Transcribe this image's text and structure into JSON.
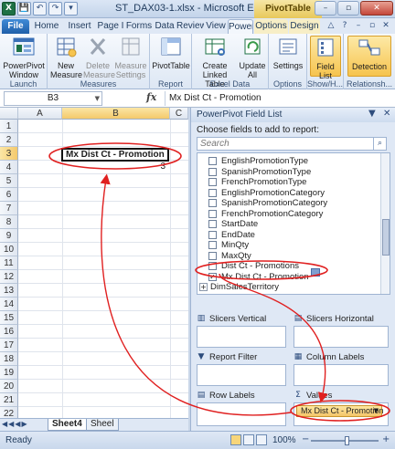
{
  "window": {
    "title": "ST_DAX03-1.xlsx - Microsoft Excel",
    "context_tab_title": "PivotTable Tools",
    "qat_items": [
      "X",
      "💾",
      "↶",
      "↷",
      "▾"
    ]
  },
  "tabs": [
    "File",
    "Home",
    "Insert",
    "Page I",
    "Forms",
    "Data",
    "Review",
    "View",
    "Power",
    "Options",
    "Design"
  ],
  "ribbon": {
    "launch": {
      "button": "PowerPivot Window",
      "group": "Launch"
    },
    "measures": {
      "new": "New Measure",
      "delete": "Delete Measure",
      "settings": "Measure Settings",
      "group": "Measures"
    },
    "report": {
      "button": "PivotTable",
      "group": "Report"
    },
    "excel_data": {
      "create_linked": "Create Linked Table",
      "update_all": "Update All",
      "group": "Excel Data"
    },
    "options": {
      "settings": "Settings",
      "group": "Options"
    },
    "show_hide": {
      "field_list": "Field List",
      "group": "Show/H..."
    },
    "relationships": {
      "detection": "Detection",
      "group": "Relationsh..."
    }
  },
  "formula_bar": {
    "name_box": "B3",
    "fx": "fx",
    "content": "Mx Dist Ct - Promotion"
  },
  "grid": {
    "columns": [
      "A",
      "B",
      "C"
    ],
    "rows": [
      "1",
      "2",
      "3",
      "4",
      "5",
      "6",
      "7",
      "8",
      "9",
      "10",
      "11",
      "12",
      "13",
      "14",
      "15",
      "16",
      "17",
      "18",
      "19",
      "20",
      "21",
      "22",
      "23",
      "24"
    ],
    "cell_b3": "Mx Dist Ct - Promotion",
    "cell_b4": "3"
  },
  "sheet_tabs": {
    "active": "Sheet4",
    "other": "Sheel"
  },
  "status": {
    "text": "Ready",
    "zoom": "100%"
  },
  "field_list": {
    "title": "PowerPivot Field List",
    "subtitle": "Choose fields to add to report:",
    "search_placeholder": "Search",
    "fields": [
      {
        "label": "EnglishPromotionType",
        "checked": false
      },
      {
        "label": "SpanishPromotionType",
        "checked": false
      },
      {
        "label": "FrenchPromotionType",
        "checked": false
      },
      {
        "label": "EnglishPromotionCategory",
        "checked": false
      },
      {
        "label": "SpanishPromotionCategory",
        "checked": false
      },
      {
        "label": "FrenchPromotionCategory",
        "checked": false
      },
      {
        "label": "StartDate",
        "checked": false
      },
      {
        "label": "EndDate",
        "checked": false
      },
      {
        "label": "MinQty",
        "checked": false
      },
      {
        "label": "MaxQty",
        "checked": false
      },
      {
        "label": "Dist Ct - Promotions",
        "checked": false
      },
      {
        "label": "Mx Dist Ct - Promotion",
        "checked": true
      }
    ],
    "tables": [
      "DimSalesTerritory",
      "FactInternetSales"
    ],
    "zones": {
      "slicers_vertical": "Slicers Vertical",
      "slicers_horizontal": "Slicers Horizontal",
      "report_filter": "Report Filter",
      "column_labels": "Column Labels",
      "row_labels": "Row Labels",
      "values": "Values",
      "values_item": "Mx Dist Ct - Promotion"
    }
  },
  "colors": {
    "accent_red": "#e02020",
    "highlight": "#f6c44f",
    "excel_green": "#1e7145"
  }
}
